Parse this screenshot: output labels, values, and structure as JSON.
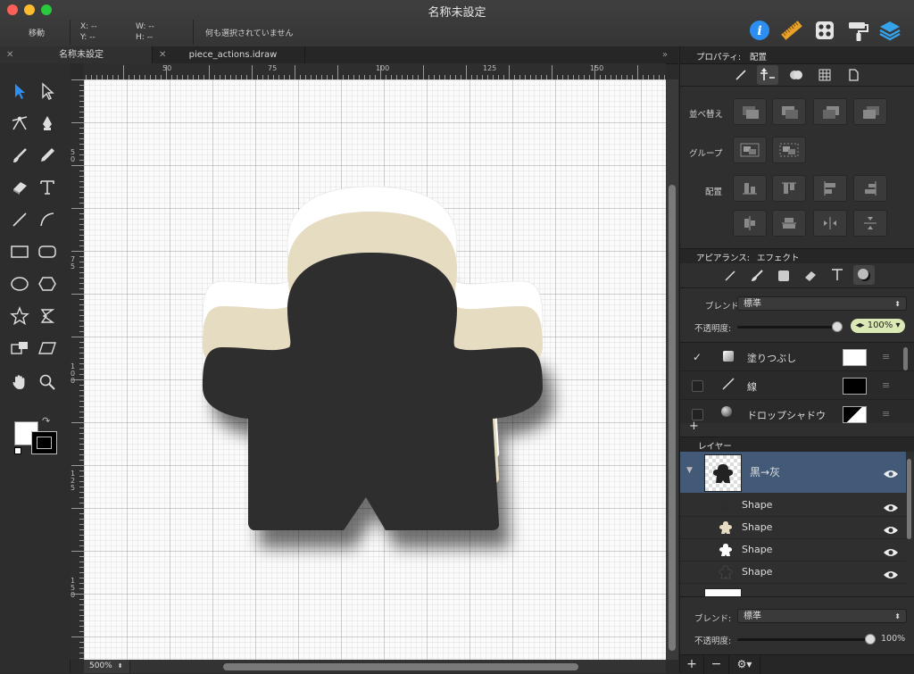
{
  "window": {
    "title": "名称未設定",
    "traffic": {
      "close": "#fc5f57",
      "minimize": "#fdbc2e",
      "zoom": "#28c83f"
    }
  },
  "toolbar": {
    "mode_label": "移動",
    "x_label": "X:",
    "x_value": "--",
    "y_label": "Y:",
    "y_value": "--",
    "w_label": "W:",
    "w_value": "--",
    "h_label": "H:",
    "h_value": "--",
    "selection_status": "何も選択されていません",
    "icons": [
      "info-icon",
      "ruler-icon",
      "grid-icon",
      "paint-roller-icon",
      "layers-icon"
    ]
  },
  "tabs": [
    {
      "label": "名称未設定",
      "active": true
    },
    {
      "label": "piece_actions.idraw",
      "active": false
    }
  ],
  "tab_overflow": "»",
  "rulers": {
    "h_ticks": [
      "50",
      "75",
      "100",
      "125",
      "150"
    ],
    "v_ticks": [
      "50",
      "75",
      "100",
      "125",
      "150"
    ]
  },
  "zoom": {
    "value": "500%"
  },
  "canvas": {
    "meeple_colors": {
      "dark": "#2e2e2e",
      "tan": "#e6dcc2",
      "white": "#ffffff"
    }
  },
  "properties": {
    "header_label": "プロパティ:",
    "header_value": "配置",
    "sections": {
      "arrange": "並べ替え",
      "group": "グループ",
      "align": "配置"
    }
  },
  "appearance": {
    "header_label": "アピアランス:",
    "header_value": "エフェクト",
    "blend_label": "ブレンド",
    "blend_value": "標準",
    "opacity_label": "不透明度:",
    "opacity_value": "100%",
    "opacity_fraction": 1.0,
    "effects": [
      {
        "label": "塗りつぶし",
        "checked": true,
        "swatch": "#ffffff"
      },
      {
        "label": "線",
        "checked": false,
        "swatch": "#000000"
      },
      {
        "label": "ドロップシャドウ",
        "checked": false,
        "swatch": "#000000"
      }
    ],
    "add_label": "+"
  },
  "layers": {
    "header": "レイヤー",
    "group_name": "黒→灰",
    "items": [
      {
        "label": "Shape",
        "color": "#2e2e2e"
      },
      {
        "label": "Shape",
        "color": "#e6dcc2"
      },
      {
        "label": "Shape",
        "color": "#ffffff"
      },
      {
        "label": "Shape",
        "color": "#2e2e2e"
      }
    ],
    "blend_label": "ブレンド:",
    "blend_value": "標準",
    "opacity_label": "不透明度:",
    "opacity_value": "100%",
    "opacity_fraction": 1.0,
    "bottom_buttons": [
      "+",
      "−"
    ]
  }
}
